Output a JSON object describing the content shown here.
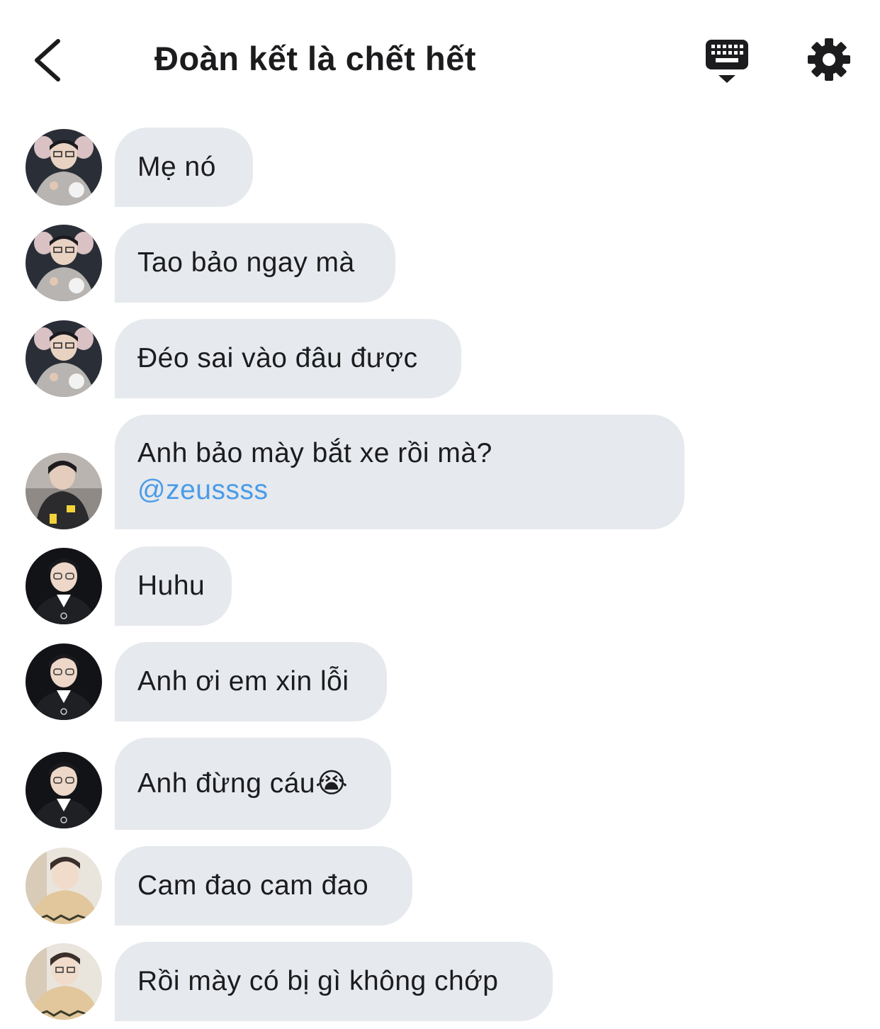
{
  "header": {
    "title": "Đoàn kết là chết hết",
    "back_icon": "chevron-left-icon",
    "keyboard_icon": "keyboard-hide-icon",
    "settings_icon": "gear-icon"
  },
  "messages": [
    {
      "avatar": "avatar-a",
      "text": "Mẹ nó"
    },
    {
      "avatar": "avatar-a",
      "text": "Tao bảo ngay mà"
    },
    {
      "avatar": "avatar-a",
      "text": "Đéo sai vào đâu được"
    },
    {
      "avatar": "avatar-b",
      "text": "Anh bảo mày bắt xe rồi mà?",
      "mention": "@zeussss"
    },
    {
      "avatar": "avatar-c",
      "text": "Huhu"
    },
    {
      "avatar": "avatar-c",
      "text": "Anh ơi em xin lỗi"
    },
    {
      "avatar": "avatar-c",
      "text": "Anh đừng cáu😭"
    },
    {
      "avatar": "avatar-d",
      "text": "Cam đao cam đao"
    },
    {
      "avatar": "avatar-d",
      "text": "Rồi mày có bị gì không chớp"
    }
  ],
  "colors": {
    "bubble": "#e6e9ed",
    "mention": "#4a9be8",
    "text": "#1c1c1e"
  }
}
